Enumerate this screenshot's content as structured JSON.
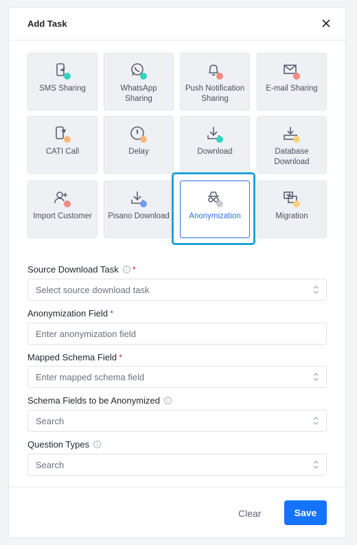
{
  "modal": {
    "title": "Add Task"
  },
  "tiles": [
    {
      "label": "SMS Sharing",
      "icon": "phone-share-icon",
      "dot": "#34d3c0"
    },
    {
      "label": "WhatsApp Sharing",
      "icon": "whatsapp-icon",
      "dot": "#34d3c0"
    },
    {
      "label": "Push Notification Sharing",
      "icon": "bell-icon",
      "dot": "#f28b82"
    },
    {
      "label": "E-mail Sharing",
      "icon": "mail-icon",
      "dot": "#f28b82"
    },
    {
      "label": "CATI Call",
      "icon": "phone-call-icon",
      "dot": "#f5b97f"
    },
    {
      "label": "Delay",
      "icon": "clock-icon",
      "dot": "#f5b97f"
    },
    {
      "label": "Download",
      "icon": "download-icon",
      "dot": "#34d3c0"
    },
    {
      "label": "Database Download",
      "icon": "database-download-icon",
      "dot": "#f5d27f"
    },
    {
      "label": "Import Customer",
      "icon": "add-user-icon",
      "dot": "#f28b82"
    },
    {
      "label": "Pisano Download",
      "icon": "download-icon",
      "dot": "#6e9cf5"
    },
    {
      "label": "Anonymization",
      "icon": "incognito-icon",
      "dot": "#c9ccd3"
    },
    {
      "label": "Migration",
      "icon": "migration-icon",
      "dot": "#f5d27f"
    }
  ],
  "selected_tile": "Anonymization",
  "form": {
    "source": {
      "label": "Source Download Task",
      "required": "*",
      "placeholder": "Select source download task"
    },
    "anon": {
      "label": "Anonymization Field",
      "required": "*",
      "placeholder": "Enter anonymization field"
    },
    "mapped": {
      "label": "Mapped Schema Field",
      "required": "*",
      "placeholder": "Enter mapped schema field"
    },
    "schema_fields": {
      "label": "Schema Fields to be Anonymized",
      "placeholder": "Search"
    },
    "question_types": {
      "label": "Question Types",
      "placeholder": "Search"
    }
  },
  "footer": {
    "clear_label": "Clear",
    "save_label": "Save"
  },
  "colors": {
    "accent": "#1673ff",
    "selection_ring": "#1ea2d8",
    "required": "#e0304a"
  }
}
